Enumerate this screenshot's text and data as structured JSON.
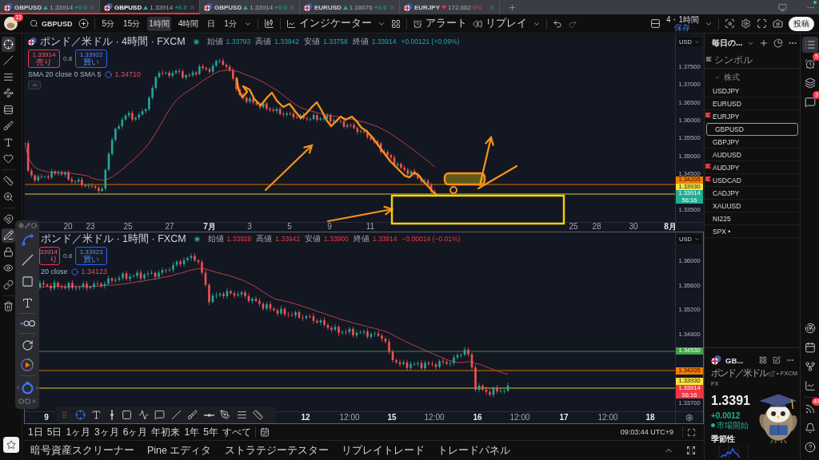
{
  "tabs": [
    {
      "symbol": "GBPUSD",
      "up": true,
      "price": "1.33914",
      "change": "+0.0",
      "selected": false,
      "underlined": true
    },
    {
      "symbol": "GBPUSD",
      "up": true,
      "price": "1.33914",
      "change": "+0.0",
      "selected": true,
      "underlined": true
    },
    {
      "symbol": "GBPUSD",
      "up": true,
      "price": "1.33914",
      "change": "+0.0",
      "selected": false,
      "underlined": false
    },
    {
      "symbol": "EURUSD",
      "up": true,
      "price": "1.16076",
      "change": "+0.0",
      "selected": false,
      "underlined": false
    },
    {
      "symbol": "EURJPY",
      "up": false,
      "price": "172.662",
      "change": "0%",
      "selected": false,
      "underlined": false
    }
  ],
  "toolbar": {
    "notifications": "13",
    "symbol": "GBPUSD",
    "intervals": [
      {
        "label": "5分",
        "selected": false
      },
      {
        "label": "15分",
        "selected": false
      },
      {
        "label": "1時間",
        "selected": true
      },
      {
        "label": "4時間",
        "selected": false
      },
      {
        "label": "日",
        "selected": false
      },
      {
        "label": "1分",
        "selected": false
      }
    ],
    "indicators": "インジケーター",
    "alert": "アラート",
    "replay": "リプレイ",
    "layout": "4・1時間",
    "layout_status": "保存",
    "publish": "投稿"
  },
  "left_tools": [
    {
      "selected": true
    },
    {
      "selected": false
    },
    {
      "selected": false
    },
    {
      "selected": false
    },
    {
      "selected": false
    },
    {
      "selected": false
    },
    {
      "selected": false
    },
    {
      "selected": false
    },
    {
      "selected": false
    },
    {
      "selected": false
    },
    {
      "selected": false
    },
    {
      "selected": true
    },
    {
      "selected": false
    },
    {
      "selected": false
    },
    {
      "selected": false
    },
    {
      "selected": false
    }
  ],
  "charts": [
    {
      "title": "ポンド／米ドル · 4時間 · FXCM",
      "rising": true,
      "ohlc": [
        {
          "label": "始値",
          "value": "1.33793"
        },
        {
          "label": "高値",
          "value": "1.33942"
        },
        {
          "label": "安値",
          "value": "1.33758"
        },
        {
          "label": "終値",
          "value": "1.33914"
        }
      ],
      "change": "+0.00121 (+0.09%)",
      "sell": {
        "price": "1.33914",
        "label": "売り"
      },
      "spread": "0.8",
      "buy": {
        "price": "1.33922",
        "label": "買い"
      },
      "indicator": {
        "name": "SMA 20 close 0 SMA 5",
        "value": "1.34710"
      },
      "collapse_button": true,
      "currency": "USD",
      "price_ticks": [
        "1.37500",
        "1.37000",
        "1.36500",
        "1.36000",
        "1.35500",
        "1.35000",
        "1.34500",
        "1.33500"
      ],
      "price_tags": [
        {
          "kind": "level",
          "value": "1.34205",
          "color": "#f57c00"
        },
        {
          "kind": "level",
          "value": "1.33930",
          "color": "#f7e43c"
        },
        {
          "kind": "current",
          "value": "1.33914",
          "countdown": "56:16",
          "color": "#22ab94"
        }
      ],
      "time_ticks": [
        {
          "label": "20",
          "major": false
        },
        {
          "label": "23",
          "major": false
        },
        {
          "label": "25",
          "major": false
        },
        {
          "label": "27",
          "major": false
        },
        {
          "label": "7月",
          "major": true
        },
        {
          "label": "3",
          "major": false
        },
        {
          "label": "5",
          "major": false
        },
        {
          "label": "9",
          "major": false
        },
        {
          "label": "11",
          "major": false
        },
        {
          "label": "25",
          "major": false
        },
        {
          "label": "28",
          "major": false
        },
        {
          "label": "30",
          "major": false
        },
        {
          "label": "8月",
          "major": true
        }
      ],
      "active": false
    },
    {
      "title": "ポンド／米ドル · 1時間 · FXCM",
      "rising": false,
      "ohlc": [
        {
          "label": "始値",
          "value": "1.33928"
        },
        {
          "label": "高値",
          "value": "1.33942"
        },
        {
          "label": "安値",
          "value": "1.33900"
        },
        {
          "label": "終値",
          "value": "1.33914"
        }
      ],
      "change": "−0.00014 (−0.01%)",
      "sell": {
        "price": "33914",
        "label": "り"
      },
      "spread": "0.8",
      "buy": {
        "price": "1.33923",
        "label": "買い"
      },
      "indicator": {
        "name": "20 close",
        "value": "1.34123"
      },
      "collapse_button": false,
      "currency": "USD",
      "price_ticks": [
        "1.36000",
        "1.35600",
        "1.35200",
        "1.34800",
        "1.33700"
      ],
      "price_tags": [
        {
          "kind": "level",
          "value": "1.34530",
          "color": "#43a047"
        },
        {
          "kind": "level",
          "value": "1.34205",
          "color": "#f57c00"
        },
        {
          "kind": "level",
          "value": "1.33930",
          "color": "#f7e43c"
        },
        {
          "kind": "current",
          "value": "1.33914",
          "countdown": "56:16",
          "color": "#f23645"
        }
      ],
      "time_ticks": [
        {
          "label": "9",
          "major": true
        },
        {
          "label": "12",
          "major": true
        },
        {
          "label": "12:00",
          "major": false
        },
        {
          "label": "15",
          "major": true
        },
        {
          "label": "12:00",
          "major": false
        },
        {
          "label": "16",
          "major": true
        },
        {
          "label": "12:00",
          "major": false
        },
        {
          "label": "17",
          "major": true
        },
        {
          "label": "12:00",
          "major": false
        },
        {
          "label": "18",
          "major": true
        }
      ],
      "active": true
    }
  ],
  "ranges": [
    "1日",
    "5日",
    "1ヶ月",
    "3ヶ月",
    "6ヶ月",
    "年初来",
    "1年",
    "5年",
    "すべて"
  ],
  "clock": "09:03:44 UTC+9",
  "bottom_tabs": [
    "暗号資産スクリーナー",
    "Pine エディタ",
    "ストラテジーテスター",
    "リプレイトレード",
    "トレードパネル"
  ],
  "watchlist": {
    "title": "毎日の...",
    "column": "シンボル",
    "group": "株式",
    "group_expanded": true,
    "items": [
      {
        "symbol": "USDJPY",
        "flagged": false,
        "selected": false
      },
      {
        "symbol": "EURUSD",
        "flagged": false,
        "selected": false
      },
      {
        "symbol": "EURJPY",
        "flagged": true,
        "selected": false
      },
      {
        "symbol": "GBPUSD",
        "flagged": false,
        "selected": true
      },
      {
        "symbol": "GBPJPY",
        "flagged": false,
        "selected": false
      },
      {
        "symbol": "AUDUSD",
        "flagged": false,
        "selected": false
      },
      {
        "symbol": "AUDJPY",
        "flagged": true,
        "selected": false
      },
      {
        "symbol": "USDCAD",
        "flagged": true,
        "selected": false
      },
      {
        "symbol": "CADJPY",
        "flagged": false,
        "selected": false
      },
      {
        "symbol": "XAUUSD",
        "flagged": false,
        "selected": false
      },
      {
        "symbol": "NI225",
        "flagged": false,
        "selected": false
      },
      {
        "symbol": "SPX •",
        "flagged": false,
        "selected": false
      }
    ]
  },
  "details": {
    "symbol": "GB...",
    "name": "ポンド／米ドル",
    "exchange": "• FXCM",
    "market": "FX",
    "price": "1.3391",
    "change": "+0.0012",
    "status": "市場開始",
    "market_open": true,
    "seasonality": "季節性"
  },
  "right_bar": [
    {
      "selected": true
    },
    {
      "badge": "5",
      "selected": false
    },
    {
      "selected": false
    },
    {
      "badge": "3",
      "selected": false
    },
    {
      "selected": false
    },
    {
      "selected": false
    },
    {
      "selected": false
    },
    {
      "selected": false
    },
    {
      "badge": "40",
      "selected": false
    },
    {
      "selected": false
    },
    {
      "selected": false
    }
  ]
}
